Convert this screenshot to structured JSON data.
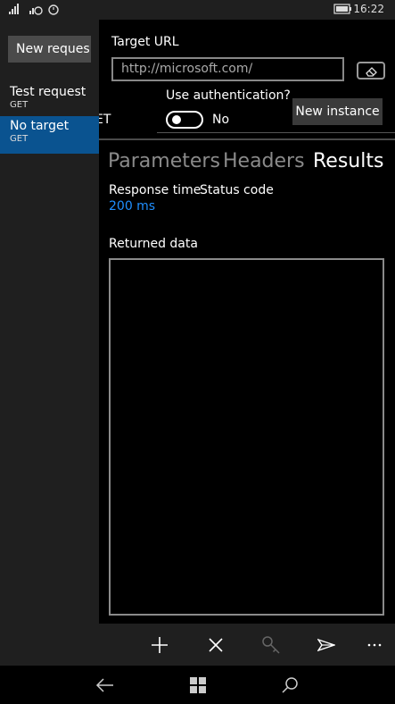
{
  "status": {
    "time": "16:22"
  },
  "sidebar": {
    "new_request_label": "New reques",
    "items": [
      {
        "title": "Test request",
        "method": "GET"
      },
      {
        "title": "No target",
        "method": "GET"
      }
    ]
  },
  "header": {
    "target_url_label": "Target URL",
    "target_url_value": "http://microsoft.com/",
    "use_auth_label": "Use authentication?",
    "auth_toggle_state": "No",
    "new_instance_label": "New instance",
    "partial_text": "ET"
  },
  "tabs": [
    {
      "label": "Parameters",
      "selected": false
    },
    {
      "label": "Headers",
      "selected": false
    },
    {
      "label": "Results",
      "selected": true
    }
  ],
  "results": {
    "response_time_label": "Response time",
    "response_time_value": "200 ms",
    "status_code_label": "Status code",
    "returned_data_label": "Returned data"
  },
  "colors": {
    "accent": "#1f8fff",
    "active_item": "#0a5390"
  },
  "app_bar": {
    "icons": [
      "add-icon",
      "close-icon",
      "key-icon",
      "send-icon",
      "more-icon"
    ]
  },
  "nav_bar": {
    "icons": [
      "back-icon",
      "windows-icon",
      "search-icon"
    ]
  }
}
